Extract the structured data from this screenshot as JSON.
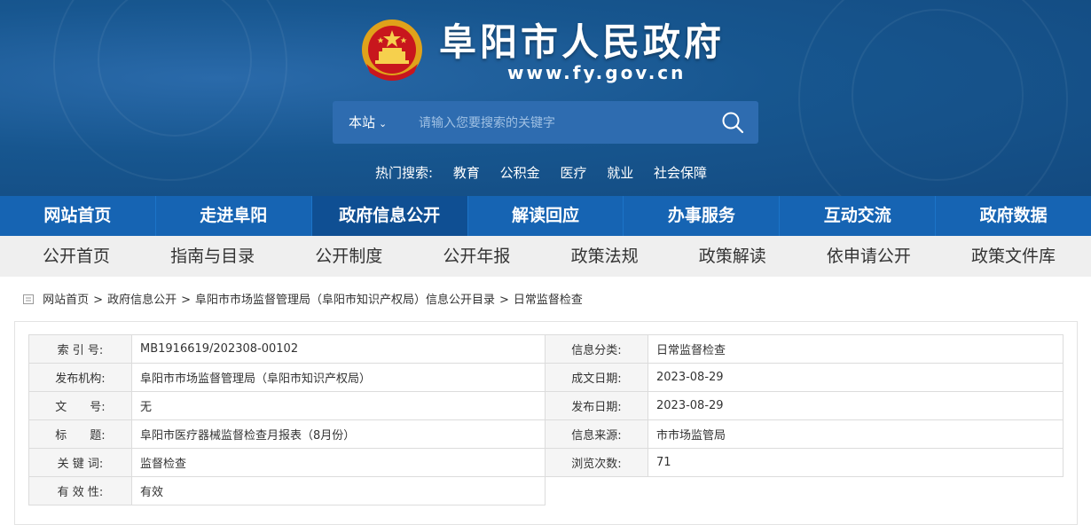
{
  "header": {
    "site_name": "阜阳市人民政府",
    "site_url": "www.fy.gov.cn",
    "emblem": "national-emblem"
  },
  "search": {
    "scope": "本站",
    "placeholder": "请输入您要搜索的关键字",
    "hot_label": "热门搜索:",
    "hot_terms": [
      "教育",
      "公积金",
      "医疗",
      "就业",
      "社会保障"
    ]
  },
  "main_nav": {
    "items": [
      "网站首页",
      "走进阜阳",
      "政府信息公开",
      "解读回应",
      "办事服务",
      "互动交流",
      "政府数据"
    ],
    "active": "政府信息公开"
  },
  "sub_nav": {
    "items": [
      "公开首页",
      "指南与目录",
      "公开制度",
      "公开年报",
      "政策法规",
      "政策解读",
      "依申请公开",
      "政策文件库"
    ]
  },
  "breadcrumb": {
    "items": [
      "网站首页",
      "政府信息公开",
      "阜阳市市场监督管理局（阜阳市知识产权局）信息公开目录",
      "日常监督检查"
    ],
    "separator": ">"
  },
  "info_left": [
    {
      "key": "索 引 号:",
      "value": "MB1916619/202308-00102"
    },
    {
      "key": "发布机构:",
      "value": "阜阳市市场监督管理局（阜阳市知识产权局）"
    },
    {
      "key": "文　　号:",
      "value": "无"
    },
    {
      "key": "标　　题:",
      "value": "阜阳市医疗器械监督检查月报表（8月份）"
    },
    {
      "key": "关 键 词:",
      "value": "监督检查"
    },
    {
      "key": "有 效 性:",
      "value": "有效"
    }
  ],
  "info_right": [
    {
      "key": "信息分类:",
      "value": "日常监督检查"
    },
    {
      "key": "成文日期:",
      "value": "2023-08-29"
    },
    {
      "key": "发布日期:",
      "value": "2023-08-29"
    },
    {
      "key": "信息来源:",
      "value": "市市场监管局"
    },
    {
      "key": "浏览次数:",
      "value": "71"
    }
  ],
  "colors": {
    "header_bg": "#17568f",
    "main_nav_bg": "#1664b3",
    "main_nav_active": "#0f4f93",
    "sub_nav_bg": "#efefef"
  }
}
